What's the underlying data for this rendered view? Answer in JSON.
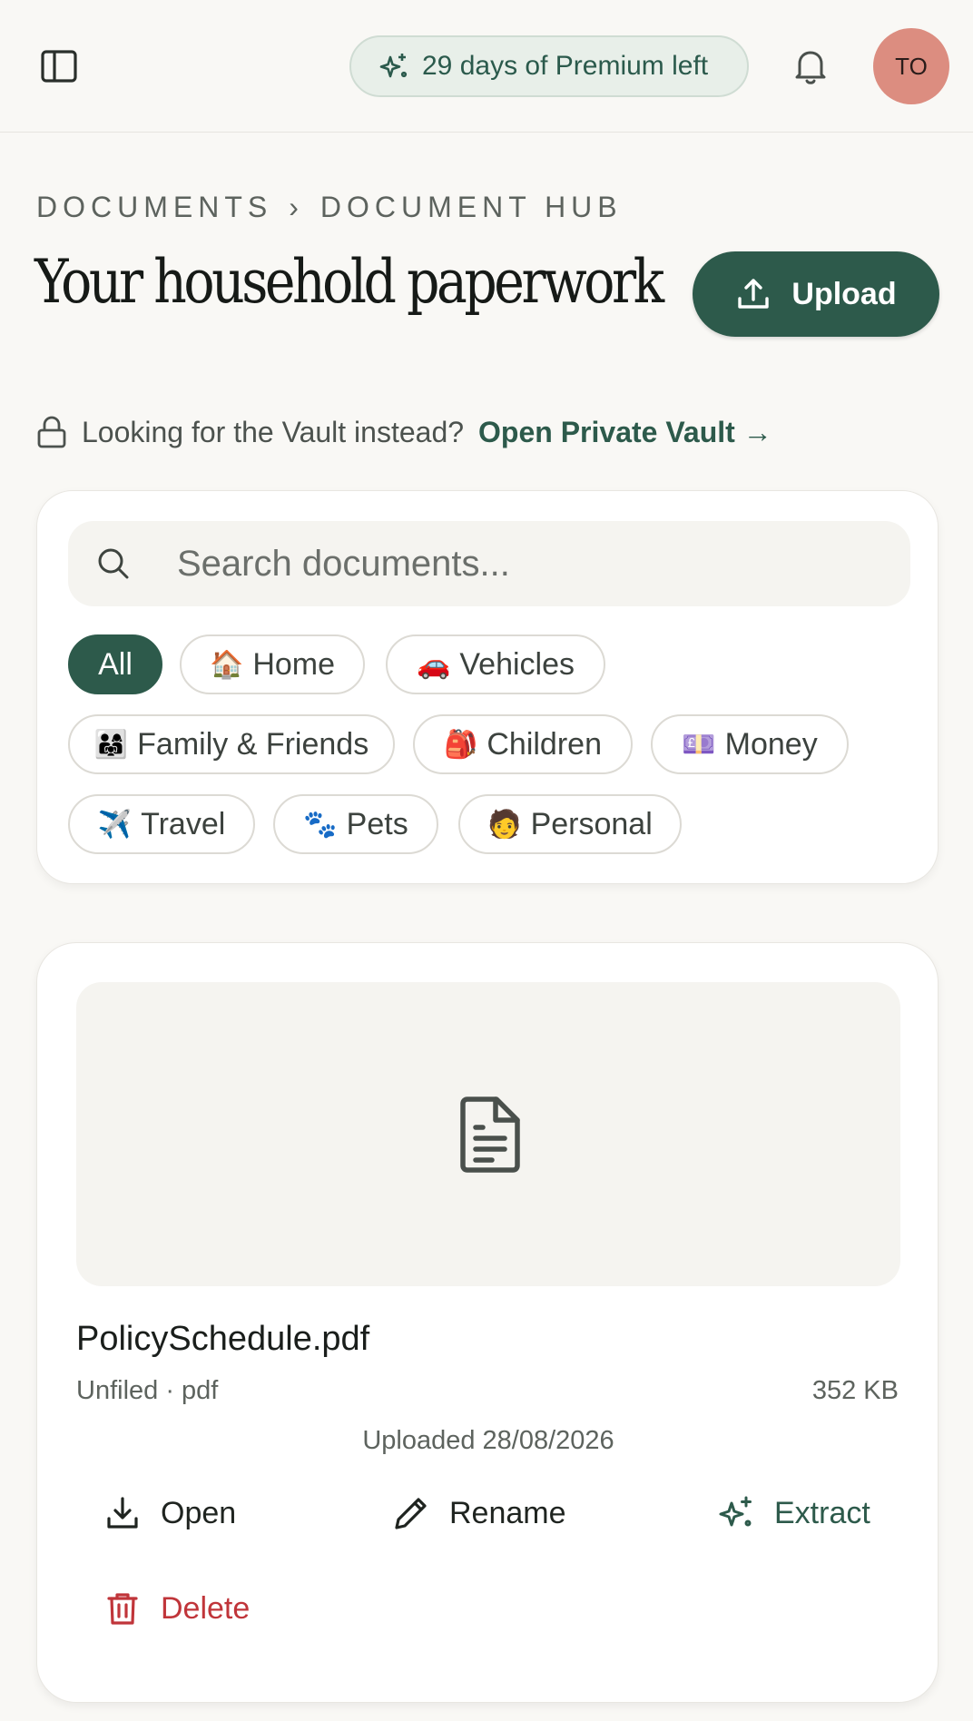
{
  "topbar": {
    "premium_label": "29 days of Premium left",
    "avatar_initials": "TO"
  },
  "header": {
    "breadcrumb": [
      "Documents",
      "Document Hub"
    ],
    "breadcrumb_separator": "›",
    "title": "Your household paperwork",
    "upload_label": "Upload"
  },
  "vault": {
    "prompt": "Looking for the Vault instead?",
    "link": "Open Private Vault →"
  },
  "search": {
    "placeholder": "Search documents...",
    "value": ""
  },
  "filters": [
    {
      "emoji": "",
      "label": "All",
      "active": true
    },
    {
      "emoji": "🏠",
      "label": "Home"
    },
    {
      "emoji": "🚗",
      "label": "Vehicles"
    },
    {
      "emoji": "👨‍👩‍👧",
      "label": "Family & Friends"
    },
    {
      "emoji": "🎒",
      "label": "Children"
    },
    {
      "emoji": "💷",
      "label": "Money"
    },
    {
      "emoji": "✈️",
      "label": "Travel"
    },
    {
      "emoji": "🐾",
      "label": "Pets"
    },
    {
      "emoji": "🧑",
      "label": "Personal"
    }
  ],
  "document": {
    "name": "PolicySchedule.pdf",
    "meta": "Unfiled · pdf",
    "size": "352 KB",
    "uploaded": "Uploaded 28/08/2026",
    "actions": {
      "open": "Open",
      "rename": "Rename",
      "extract": "Extract",
      "delete": "Delete"
    }
  },
  "colors": {
    "accent": "#2d5a4b",
    "background": "#f9f8f5",
    "avatar": "#dc8d80",
    "danger": "#c0353a"
  }
}
